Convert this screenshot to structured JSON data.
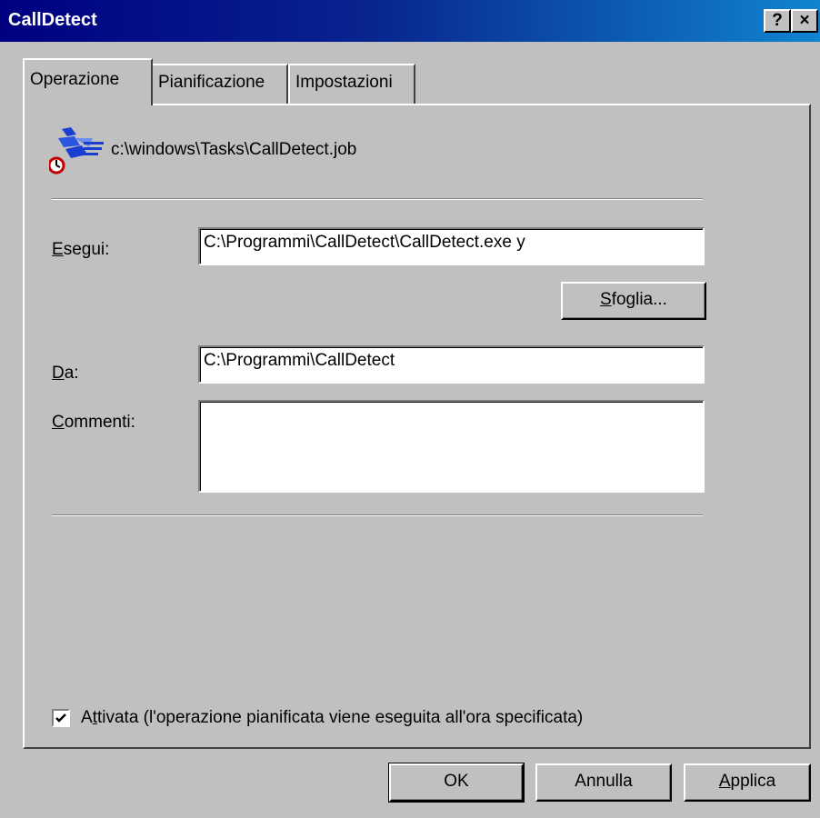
{
  "window": {
    "title": "CallDetect",
    "help_button": "?",
    "close_button": "×"
  },
  "tabs": [
    {
      "label_underlined": "",
      "label": "Operazione"
    },
    {
      "label": "Pianificazione"
    },
    {
      "label": "Impostazioni"
    }
  ],
  "task_file": "c:\\windows\\Tasks\\CallDetect.job",
  "run": {
    "label_hotkey": "E",
    "label_rest": "segui:",
    "value": "C:\\Programmi\\CallDetect\\CallDetect.exe y"
  },
  "browse": {
    "label_hotkey": "S",
    "label_rest": "foglia..."
  },
  "start_in": {
    "label_hotkey": "D",
    "label_rest": "a:",
    "value": "C:\\Programmi\\CallDetect"
  },
  "comments": {
    "label_hotkey": "C",
    "label_rest": "ommenti:",
    "value": ""
  },
  "enabled": {
    "checked": true,
    "label_prefix": "A",
    "label_hotkey": "t",
    "label_rest": "tivata (l'operazione pianificata viene eseguita all'ora specificata)"
  },
  "footer": {
    "ok": "OK",
    "cancel": "Annulla",
    "apply_hotkey": "A",
    "apply_rest": "pplica"
  }
}
